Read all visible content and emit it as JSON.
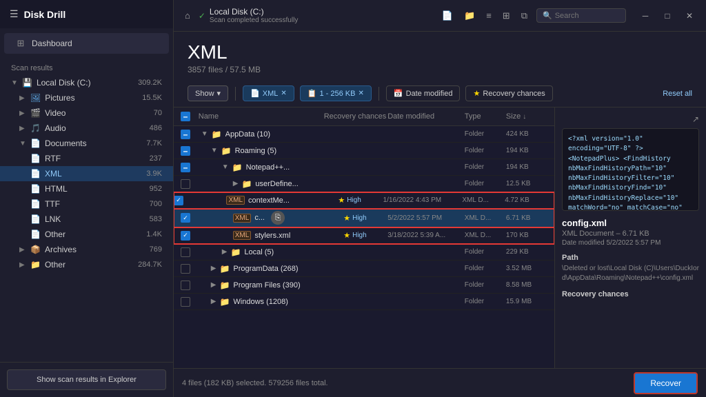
{
  "sidebar": {
    "app_title": "Disk Drill",
    "hamburger": "☰",
    "dashboard_label": "Dashboard",
    "section_label": "Scan results",
    "items": [
      {
        "label": "Local Disk (C:)",
        "count": "309.2K",
        "icon": "💾",
        "has_chevron": true,
        "expanded": true
      },
      {
        "label": "Pictures",
        "count": "15.5K",
        "icon": "🖼",
        "has_chevron": true,
        "expanded": false
      },
      {
        "label": "Video",
        "count": "70",
        "icon": "🎬",
        "has_chevron": true,
        "expanded": false
      },
      {
        "label": "Audio",
        "count": "486",
        "icon": "🎵",
        "has_chevron": true,
        "expanded": false
      },
      {
        "label": "Documents",
        "count": "7.7K",
        "icon": "📄",
        "has_chevron": true,
        "expanded": true,
        "children": [
          {
            "label": "RTF",
            "count": "237",
            "icon": "📄"
          },
          {
            "label": "XML",
            "count": "3.9K",
            "icon": "📄",
            "selected": true
          },
          {
            "label": "HTML",
            "count": "952",
            "icon": "📄"
          },
          {
            "label": "TTF",
            "count": "700",
            "icon": "📄"
          },
          {
            "label": "LNK",
            "count": "583",
            "icon": "📄"
          },
          {
            "label": "Other",
            "count": "1.4K",
            "icon": "📄"
          }
        ]
      },
      {
        "label": "Archives",
        "count": "769",
        "icon": "📦",
        "has_chevron": true,
        "expanded": false
      },
      {
        "label": "Other",
        "count": "284.7K",
        "icon": "📁",
        "has_chevron": true,
        "expanded": false
      }
    ],
    "scan_results_btn": "Show scan results in Explorer"
  },
  "topbar": {
    "location_name": "Local Disk (C:)",
    "location_status": "Scan completed successfully",
    "search_placeholder": "Search",
    "window_min": "─",
    "window_max": "□",
    "window_close": "✕"
  },
  "page": {
    "title": "XML",
    "subtitle": "3857 files / 57.5 MB"
  },
  "filters": {
    "show_label": "Show",
    "xml_tag": "XML",
    "size_tag": "1 - 256 KB",
    "date_btn": "Date modified",
    "recovery_btn": "Recovery chances",
    "reset_all": "Reset all"
  },
  "table": {
    "col_name": "Name",
    "col_recovery": "Recovery chances",
    "col_date": "Date modified",
    "col_type": "Type",
    "col_size": "Size",
    "rows": [
      {
        "indent": 1,
        "type": "folder",
        "name": "AppData (10)",
        "recovery": "",
        "date": "",
        "filetype": "Folder",
        "size": "424 KB",
        "checked": "indeterminate"
      },
      {
        "indent": 2,
        "type": "folder",
        "name": "Roaming (5)",
        "recovery": "",
        "date": "",
        "filetype": "Folder",
        "size": "194 KB",
        "checked": "indeterminate"
      },
      {
        "indent": 3,
        "type": "folder",
        "name": "Notepad++...",
        "recovery": "",
        "date": "",
        "filetype": "Folder",
        "size": "194 KB",
        "checked": "indeterminate"
      },
      {
        "indent": 4,
        "type": "folder",
        "name": "userDefine...",
        "recovery": "",
        "date": "",
        "filetype": "Folder",
        "size": "12.5 KB",
        "checked": "none"
      },
      {
        "indent": 4,
        "type": "xml",
        "name": "contextMe...",
        "recovery": "High",
        "date": "1/16/2022 4:43 PM",
        "filetype": "XML D...",
        "size": "4.72 KB",
        "checked": "checked",
        "starred": true
      },
      {
        "indent": 4,
        "type": "xml",
        "name": "c...",
        "recovery": "High",
        "date": "5/2/2022 5:57 PM",
        "filetype": "XML D...",
        "size": "6.71 KB",
        "checked": "checked",
        "starred": true,
        "selected": true
      },
      {
        "indent": 4,
        "type": "xml",
        "name": "stylers.xml",
        "recovery": "High",
        "date": "3/18/2022 5:39 A...",
        "filetype": "XML D...",
        "size": "170 KB",
        "checked": "checked",
        "starred": true
      },
      {
        "indent": 3,
        "type": "folder",
        "name": "Local (5)",
        "recovery": "",
        "date": "",
        "filetype": "Folder",
        "size": "229 KB",
        "checked": "none"
      },
      {
        "indent": 2,
        "type": "folder",
        "name": "ProgramData (268)",
        "recovery": "",
        "date": "",
        "filetype": "Folder",
        "size": "3.52 MB",
        "checked": "none"
      },
      {
        "indent": 2,
        "type": "folder",
        "name": "Program Files (390)",
        "recovery": "",
        "date": "",
        "filetype": "Folder",
        "size": "8.58 MB",
        "checked": "none"
      },
      {
        "indent": 2,
        "type": "folder",
        "name": "Windows (1208)",
        "recovery": "",
        "date": "",
        "filetype": "Folder",
        "size": "15.9 MB",
        "checked": "none"
      }
    ]
  },
  "preview": {
    "xml_content": "<?xml version=\"1.0\"\nencoding=\"UTF-8\" ?>\n<NotepadPlus>\n    <FindHistory\nnbMaxFindHistoryPath=\"10\"\nnbMaxFindHistoryFilter=\"10\"\nnbMaxFindHistoryFind=\"10\"\nnbMaxFindHistoryReplace=\"10\"\nmatchWord=\"no\"\nmatchCase=\"no\" wrap=\"yes\"",
    "filename": "config.xml",
    "filetype": "XML Document – 6.71 KB",
    "date_label": "Date modified 5/2/2022 5:57 PM",
    "path_section": "Path",
    "path_value": "\\Deleted or lost\\Local Disk (C)\\Users\\DuckIord\\AppData\\Roaming\\Notepad++\\config.xml",
    "recovery_section": "Recovery chances"
  },
  "statusbar": {
    "text": "4 files (182 KB) selected. 579256 files total.",
    "recover_btn": "Recover"
  }
}
